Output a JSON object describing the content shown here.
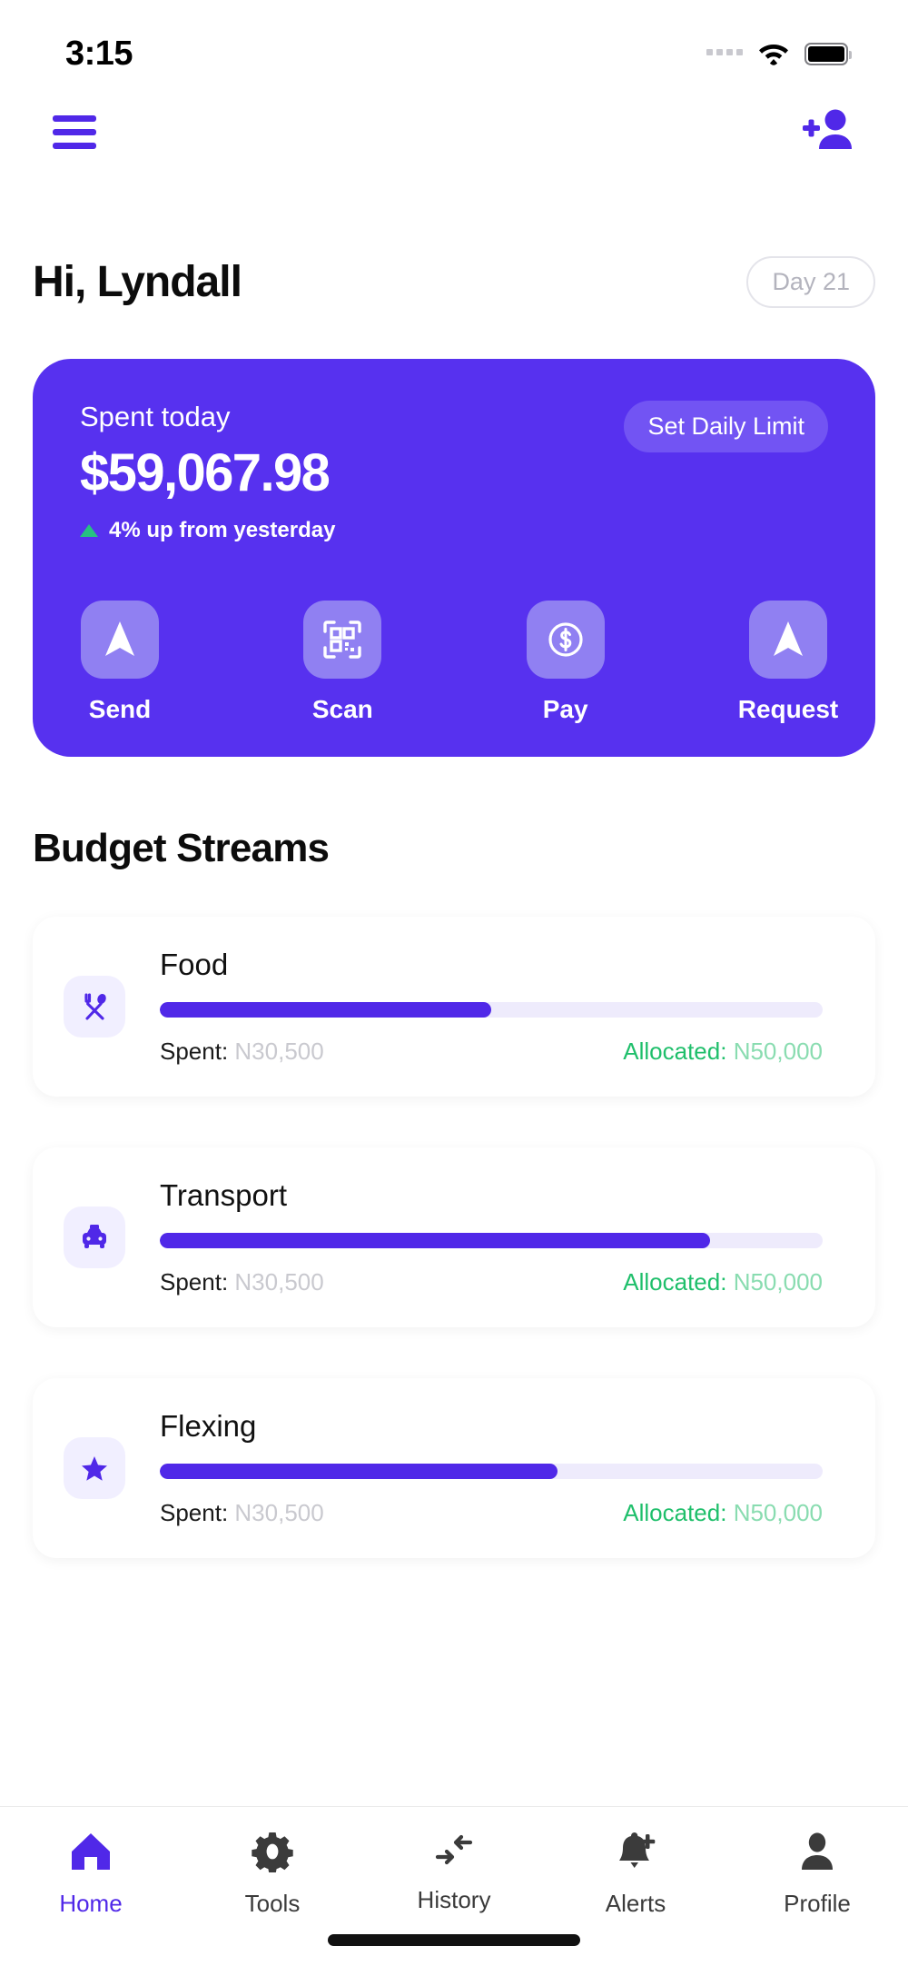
{
  "status_bar": {
    "time": "3:15",
    "signal_icon": "signal-dots-icon",
    "wifi_icon": "wifi-icon",
    "battery_icon": "battery-full-icon"
  },
  "app_bar": {
    "menu_icon": "hamburger-menu-icon",
    "add_user_icon": "add-person-icon"
  },
  "header": {
    "greeting": "Hi, Lyndall",
    "day_badge": "Day 21"
  },
  "balance_card": {
    "spent_label": "Spent today",
    "amount": "$59,067.98",
    "delta_text": "4% up from yesterday",
    "delta_direction": "up",
    "limit_button": "Set Daily Limit",
    "background_color": "#5731EF",
    "actions": [
      {
        "label": "Send",
        "icon": "navigation-arrow-icon"
      },
      {
        "label": "Scan",
        "icon": "qr-code-icon"
      },
      {
        "label": "Pay",
        "icon": "dollar-circle-icon"
      },
      {
        "label": "Request",
        "icon": "navigation-arrow-icon"
      }
    ]
  },
  "budget": {
    "section_title": "Budget Streams",
    "spent_label": "Spent:",
    "allocated_label": "Allocated:",
    "streams": [
      {
        "name": "Food",
        "icon": "fork-spoon-icon",
        "spent": "N30,500",
        "allocated": "N50,000",
        "progress_percent": 50
      },
      {
        "name": "Transport",
        "icon": "taxi-icon",
        "spent": "N30,500",
        "allocated": "N50,000",
        "progress_percent": 83
      },
      {
        "name": "Flexing",
        "icon": "star-icon",
        "spent": "N30,500",
        "allocated": "N50,000",
        "progress_percent": 60
      }
    ]
  },
  "bottom_nav": {
    "active": "Home",
    "items": [
      {
        "label": "Home",
        "icon": "home-icon"
      },
      {
        "label": "Tools",
        "icon": "gear-icon"
      },
      {
        "label": "History",
        "icon": "transfer-arrows-icon"
      },
      {
        "label": "Alerts",
        "icon": "bell-plus-icon"
      },
      {
        "label": "Profile",
        "icon": "person-icon"
      }
    ]
  },
  "colors": {
    "accent": "#5028E8",
    "card": "#5731EF",
    "tile": "#9080F2",
    "green": "#1FBF6B",
    "muted": "#C9C9CF"
  }
}
